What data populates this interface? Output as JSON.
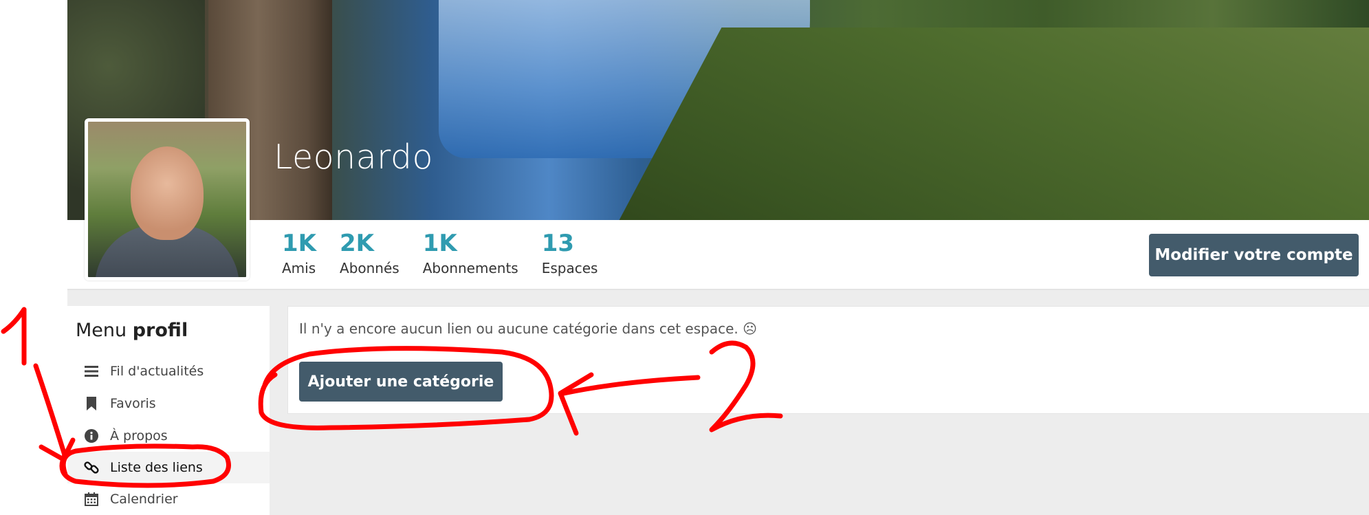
{
  "profile": {
    "name": "Leonardo",
    "stats": [
      {
        "value": "1K",
        "label": "Amis"
      },
      {
        "value": "2K",
        "label": "Abonnés"
      },
      {
        "value": "1K",
        "label": "Abonnements"
      },
      {
        "value": "13",
        "label": "Espaces"
      }
    ],
    "edit_button": "Modifier votre compte"
  },
  "menu": {
    "title_prefix": "Menu",
    "title_bold": "profil",
    "items": [
      {
        "label": "Fil d'actualités",
        "icon": "bars-icon"
      },
      {
        "label": "Favoris",
        "icon": "bookmark-icon"
      },
      {
        "label": "À propos",
        "icon": "info-icon"
      },
      {
        "label": "Liste des liens",
        "icon": "link-icon",
        "active": true
      },
      {
        "label": "Calendrier",
        "icon": "calendar-icon"
      }
    ]
  },
  "content": {
    "empty_message": "Il n'y a encore aucun lien ou aucune catégorie dans cet espace. ☹",
    "add_category_button": "Ajouter une catégorie"
  },
  "annotations": {
    "color": "#ff0000",
    "number_one": "1",
    "number_two": "2"
  }
}
